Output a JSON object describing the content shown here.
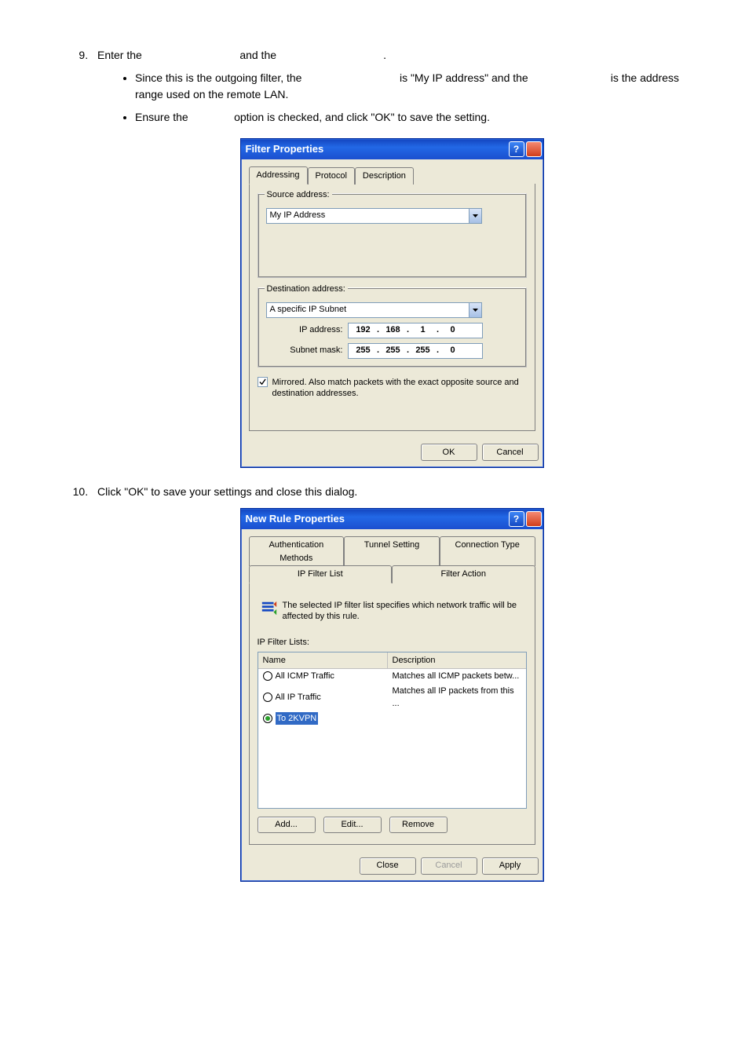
{
  "instructions": {
    "step9_a": "Enter the",
    "step9_b": "and the",
    "bullet1_a": "Since this is the outgoing filter, the",
    "bullet1_b": "is \"My IP address\" and the",
    "bullet1_c": "is the address range used on the remote LAN.",
    "bullet2_a": "Ensure the",
    "bullet2_b": "option is checked, and click \"OK\" to save the setting.",
    "step10": "Click \"OK\" to save your settings and close this dialog."
  },
  "dlg1": {
    "title": "Filter Properties",
    "tabs": {
      "addressing": "Addressing",
      "protocol": "Protocol",
      "description": "Description"
    },
    "src": {
      "legend": "Source address:",
      "value": "My IP Address"
    },
    "dst": {
      "legend": "Destination address:",
      "value": "A specific IP Subnet",
      "ip_label": "IP address:",
      "ip": [
        "192",
        "168",
        "1",
        "0"
      ],
      "mask_label": "Subnet mask:",
      "mask": [
        "255",
        "255",
        "255",
        "0"
      ]
    },
    "mirrored": "Mirrored. Also match packets with the exact opposite source and destination addresses.",
    "ok": "OK",
    "cancel": "Cancel"
  },
  "dlg2": {
    "title": "New Rule Properties",
    "tabs_top": {
      "auth": "Authentication Methods",
      "tunnel": "Tunnel Setting",
      "conn": "Connection Type"
    },
    "tabs_bot": {
      "iplist": "IP Filter List",
      "faction": "Filter Action"
    },
    "desc": "The selected IP filter list specifies which network traffic will be affected by this rule.",
    "lists_label": "IP Filter Lists:",
    "headers": {
      "name": "Name",
      "desc": "Description"
    },
    "rows": [
      {
        "name": "All ICMP Traffic",
        "desc": "Matches all ICMP packets betw...",
        "selected": false
      },
      {
        "name": "All IP Traffic",
        "desc": "Matches all IP packets from this ...",
        "selected": false
      },
      {
        "name": "To 2KVPN",
        "desc": "",
        "selected": true
      }
    ],
    "add": "Add...",
    "edit": "Edit...",
    "remove": "Remove",
    "close": "Close",
    "cancel": "Cancel",
    "apply": "Apply"
  }
}
